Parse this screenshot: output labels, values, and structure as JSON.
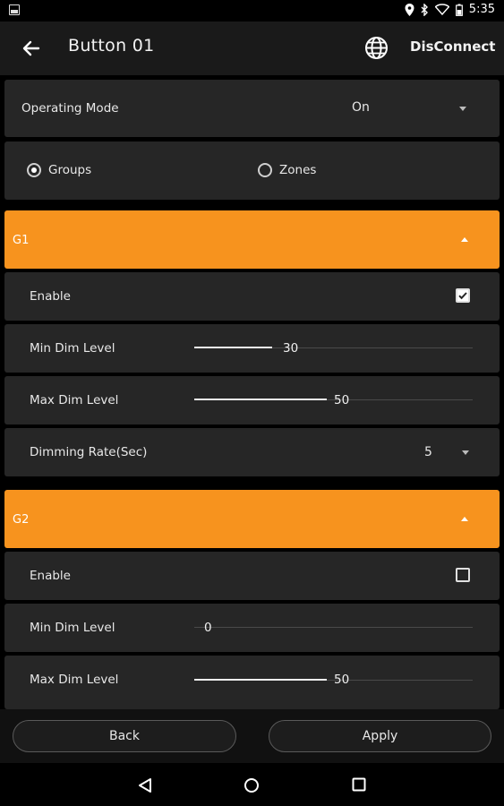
{
  "status_bar": {
    "time": "5:35"
  },
  "app_bar": {
    "title": "Button 01",
    "disconnect_label": "DisConnect"
  },
  "operating_mode": {
    "label": "Operating Mode",
    "value": "On"
  },
  "selection": {
    "options": [
      {
        "label": "Groups",
        "selected": true
      },
      {
        "label": "Zones",
        "selected": false
      }
    ]
  },
  "groups": [
    {
      "name": "G1",
      "enable_label": "Enable",
      "enabled": true,
      "min_dim": {
        "label": "Min Dim Level",
        "value": "30"
      },
      "max_dim": {
        "label": "Max Dim Level",
        "value": "50"
      },
      "dimming_rate": {
        "label": "Dimming Rate(Sec)",
        "value": "5"
      }
    },
    {
      "name": "G2",
      "enable_label": "Enable",
      "enabled": false,
      "min_dim": {
        "label": "Min Dim Level",
        "value": "0"
      },
      "max_dim": {
        "label": "Max Dim Level",
        "value": "50"
      }
    }
  ],
  "footer": {
    "back_label": "Back",
    "apply_label": "Apply"
  },
  "colors": {
    "accent": "#f7931e",
    "card": "#262626",
    "background": "#000000"
  },
  "icons": [
    "back-arrow-icon",
    "globe-icon",
    "location-icon",
    "bluetooth-icon",
    "wifi-icon",
    "battery-icon",
    "nav-back-icon",
    "nav-home-icon",
    "nav-recents-icon"
  ]
}
